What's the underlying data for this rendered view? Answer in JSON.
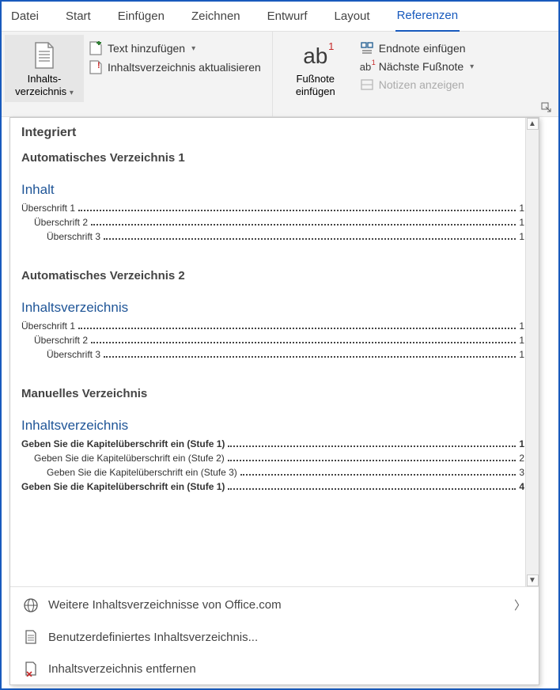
{
  "tabs": [
    "Datei",
    "Start",
    "Einfügen",
    "Zeichnen",
    "Entwurf",
    "Layout",
    "Referenzen"
  ],
  "active_tab_index": 6,
  "ribbon": {
    "toc_button": {
      "line1": "Inhalts-",
      "line2": "verzeichnis"
    },
    "add_text": "Text hinzufügen",
    "update_toc": "Inhaltsverzeichnis aktualisieren",
    "footnote_button": {
      "line1": "Fußnote",
      "line2": "einfügen"
    },
    "insert_endnote": "Endnote einfügen",
    "next_footnote": "Nächste Fußnote",
    "show_notes": "Notizen anzeigen"
  },
  "gallery": {
    "section_header": "Integriert",
    "items": [
      {
        "title": "Automatisches Verzeichnis 1",
        "toc_title": "Inhalt",
        "lines": [
          {
            "label": "Überschrift 1",
            "page": "1",
            "indent": 0
          },
          {
            "label": "Überschrift 2",
            "page": "1",
            "indent": 1
          },
          {
            "label": "Überschrift 3",
            "page": "1",
            "indent": 2
          }
        ]
      },
      {
        "title": "Automatisches Verzeichnis 2",
        "toc_title": "Inhaltsverzeichnis",
        "lines": [
          {
            "label": "Überschrift 1",
            "page": "1",
            "indent": 0
          },
          {
            "label": "Überschrift 2",
            "page": "1",
            "indent": 1
          },
          {
            "label": "Überschrift 3",
            "page": "1",
            "indent": 2
          }
        ]
      },
      {
        "title": "Manuelles Verzeichnis",
        "toc_title": "Inhaltsverzeichnis",
        "lines": [
          {
            "label": "Geben Sie die Kapitelüberschrift ein (Stufe 1)",
            "page": "1",
            "indent": 0,
            "bold": true
          },
          {
            "label": "Geben Sie die Kapitelüberschrift ein (Stufe 2)",
            "page": "2",
            "indent": 1
          },
          {
            "label": "Geben Sie die Kapitelüberschrift ein (Stufe 3)",
            "page": "3",
            "indent": 2
          },
          {
            "label": "Geben Sie die Kapitelüberschrift ein (Stufe 1)",
            "page": "4",
            "indent": 0,
            "bold": true
          }
        ]
      }
    ],
    "footer": {
      "more_office": "Weitere Inhaltsverzeichnisse von Office.com",
      "custom_toc": "Benutzerdefiniertes Inhaltsverzeichnis...",
      "remove_toc": "Inhaltsverzeichnis entfernen"
    }
  }
}
